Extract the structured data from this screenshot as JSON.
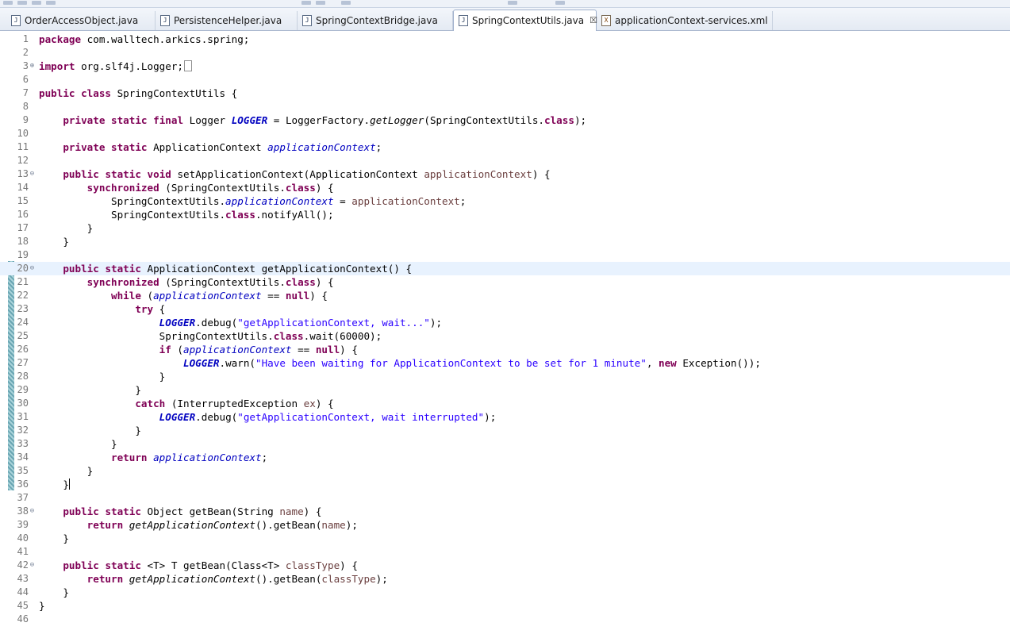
{
  "editor": {
    "tabs": [
      {
        "label": "OrderAccessObject.java",
        "icon": "java-file-icon",
        "active": false
      },
      {
        "label": "PersistenceHelper.java",
        "icon": "java-file-icon",
        "active": false
      },
      {
        "label": "SpringContextBridge.java",
        "icon": "java-file-icon",
        "active": false
      },
      {
        "label": "SpringContextUtils.java",
        "icon": "java-file-icon",
        "active": true,
        "close": "☒"
      },
      {
        "label": "applicationContext-services.xml",
        "icon": "xml-file-icon",
        "active": false
      }
    ],
    "current_line": 20,
    "code_lines": [
      {
        "n": "1",
        "tokens": [
          [
            "kw",
            "package"
          ],
          [
            "p",
            " com.walltech.arkics.spring;"
          ]
        ]
      },
      {
        "n": "2",
        "tokens": []
      },
      {
        "n": "3",
        "fold": "⊕",
        "tokens": [
          [
            "kw",
            "import"
          ],
          [
            "p",
            " org.slf4j.Logger;"
          ],
          [
            "box",
            ""
          ]
        ]
      },
      {
        "n": "6",
        "tokens": []
      },
      {
        "n": "7",
        "tokens": [
          [
            "kw",
            "public"
          ],
          [
            "p",
            " "
          ],
          [
            "kw",
            "class"
          ],
          [
            "p",
            " SpringContextUtils {"
          ]
        ]
      },
      {
        "n": "8",
        "tokens": []
      },
      {
        "n": "9",
        "tokens": [
          [
            "p",
            "    "
          ],
          [
            "kw",
            "private"
          ],
          [
            "p",
            " "
          ],
          [
            "kw",
            "static"
          ],
          [
            "p",
            " "
          ],
          [
            "kw",
            "final"
          ],
          [
            "p",
            " Logger "
          ],
          [
            "sf",
            "LOGGER"
          ],
          [
            "p",
            " = LoggerFactory."
          ],
          [
            "smeth",
            "getLogger"
          ],
          [
            "p",
            "(SpringContextUtils."
          ],
          [
            "kw",
            "class"
          ],
          [
            "p",
            ");"
          ]
        ]
      },
      {
        "n": "10",
        "tokens": []
      },
      {
        "n": "11",
        "tokens": [
          [
            "p",
            "    "
          ],
          [
            "kw",
            "private"
          ],
          [
            "p",
            " "
          ],
          [
            "kw",
            "static"
          ],
          [
            "p",
            " ApplicationContext "
          ],
          [
            "fld",
            "applicationContext"
          ],
          [
            "p",
            ";"
          ]
        ]
      },
      {
        "n": "12",
        "tokens": []
      },
      {
        "n": "13",
        "fold": "⊖",
        "tokens": [
          [
            "p",
            "    "
          ],
          [
            "kw",
            "public"
          ],
          [
            "p",
            " "
          ],
          [
            "kw",
            "static"
          ],
          [
            "p",
            " "
          ],
          [
            "kw",
            "void"
          ],
          [
            "p",
            " setApplicationContext(ApplicationContext "
          ],
          [
            "par",
            "applicationContext"
          ],
          [
            "p",
            ") {"
          ]
        ]
      },
      {
        "n": "14",
        "tokens": [
          [
            "p",
            "        "
          ],
          [
            "kw",
            "synchronized"
          ],
          [
            "p",
            " (SpringContextUtils."
          ],
          [
            "kw",
            "class"
          ],
          [
            "p",
            ") {"
          ]
        ]
      },
      {
        "n": "15",
        "tokens": [
          [
            "p",
            "            SpringContextUtils."
          ],
          [
            "fld",
            "applicationContext"
          ],
          [
            "p",
            " = "
          ],
          [
            "par",
            "applicationContext"
          ],
          [
            "p",
            ";"
          ]
        ]
      },
      {
        "n": "16",
        "tokens": [
          [
            "p",
            "            SpringContextUtils."
          ],
          [
            "kw",
            "class"
          ],
          [
            "p",
            ".notifyAll();"
          ]
        ]
      },
      {
        "n": "17",
        "tokens": [
          [
            "p",
            "        }"
          ]
        ]
      },
      {
        "n": "18",
        "tokens": [
          [
            "p",
            "    }"
          ]
        ]
      },
      {
        "n": "19",
        "tokens": []
      },
      {
        "n": "20",
        "fold": "⊖",
        "tokens": [
          [
            "p",
            "    "
          ],
          [
            "kw",
            "public"
          ],
          [
            "p",
            " "
          ],
          [
            "kw",
            "static"
          ],
          [
            "p",
            " ApplicationContext getApplicationContext() {"
          ]
        ]
      },
      {
        "n": "21",
        "tokens": [
          [
            "p",
            "        "
          ],
          [
            "kw",
            "synchronized"
          ],
          [
            "p",
            " (SpringContextUtils."
          ],
          [
            "kw",
            "class"
          ],
          [
            "p",
            ") {"
          ]
        ]
      },
      {
        "n": "22",
        "tokens": [
          [
            "p",
            "            "
          ],
          [
            "kw",
            "while"
          ],
          [
            "p",
            " ("
          ],
          [
            "fld",
            "applicationContext"
          ],
          [
            "p",
            " == "
          ],
          [
            "kw",
            "null"
          ],
          [
            "p",
            ") {"
          ]
        ]
      },
      {
        "n": "23",
        "tokens": [
          [
            "p",
            "                "
          ],
          [
            "kw",
            "try"
          ],
          [
            "p",
            " {"
          ]
        ]
      },
      {
        "n": "24",
        "tokens": [
          [
            "p",
            "                    "
          ],
          [
            "sf",
            "LOGGER"
          ],
          [
            "p",
            ".debug("
          ],
          [
            "str",
            "\"getApplicationContext, wait...\""
          ],
          [
            "p",
            ");"
          ]
        ]
      },
      {
        "n": "25",
        "tokens": [
          [
            "p",
            "                    SpringContextUtils."
          ],
          [
            "kw",
            "class"
          ],
          [
            "p",
            ".wait(60000);"
          ]
        ]
      },
      {
        "n": "26",
        "tokens": [
          [
            "p",
            "                    "
          ],
          [
            "kw",
            "if"
          ],
          [
            "p",
            " ("
          ],
          [
            "fld",
            "applicationContext"
          ],
          [
            "p",
            " == "
          ],
          [
            "kw",
            "null"
          ],
          [
            "p",
            ") {"
          ]
        ]
      },
      {
        "n": "27",
        "tokens": [
          [
            "p",
            "                        "
          ],
          [
            "sf",
            "LOGGER"
          ],
          [
            "p",
            ".warn("
          ],
          [
            "str",
            "\"Have been waiting for ApplicationContext to be set for 1 minute\""
          ],
          [
            "p",
            ", "
          ],
          [
            "kw",
            "new"
          ],
          [
            "p",
            " Exception());"
          ]
        ]
      },
      {
        "n": "28",
        "tokens": [
          [
            "p",
            "                    }"
          ]
        ]
      },
      {
        "n": "29",
        "tokens": [
          [
            "p",
            "                }"
          ]
        ]
      },
      {
        "n": "30",
        "tokens": [
          [
            "p",
            "                "
          ],
          [
            "kw",
            "catch"
          ],
          [
            "p",
            " (InterruptedException "
          ],
          [
            "par",
            "ex"
          ],
          [
            "p",
            ") {"
          ]
        ]
      },
      {
        "n": "31",
        "tokens": [
          [
            "p",
            "                    "
          ],
          [
            "sf",
            "LOGGER"
          ],
          [
            "p",
            ".debug("
          ],
          [
            "str",
            "\"getApplicationContext, wait interrupted\""
          ],
          [
            "p",
            ");"
          ]
        ]
      },
      {
        "n": "32",
        "tokens": [
          [
            "p",
            "                }"
          ]
        ]
      },
      {
        "n": "33",
        "tokens": [
          [
            "p",
            "            }"
          ]
        ]
      },
      {
        "n": "34",
        "tokens": [
          [
            "p",
            "            "
          ],
          [
            "kw",
            "return"
          ],
          [
            "p",
            " "
          ],
          [
            "fld",
            "applicationContext"
          ],
          [
            "p",
            ";"
          ]
        ]
      },
      {
        "n": "35",
        "tokens": [
          [
            "p",
            "        }"
          ]
        ]
      },
      {
        "n": "36",
        "tokens": [
          [
            "p",
            "    }"
          ],
          [
            "caret",
            ""
          ]
        ]
      },
      {
        "n": "37",
        "tokens": []
      },
      {
        "n": "38",
        "fold": "⊖",
        "tokens": [
          [
            "p",
            "    "
          ],
          [
            "kw",
            "public"
          ],
          [
            "p",
            " "
          ],
          [
            "kw",
            "static"
          ],
          [
            "p",
            " Object getBean(String "
          ],
          [
            "par",
            "name"
          ],
          [
            "p",
            ") {"
          ]
        ]
      },
      {
        "n": "39",
        "tokens": [
          [
            "p",
            "        "
          ],
          [
            "kw",
            "return"
          ],
          [
            "p",
            " "
          ],
          [
            "smeth",
            "getApplicationContext"
          ],
          [
            "p",
            "().getBean("
          ],
          [
            "par",
            "name"
          ],
          [
            "p",
            ");"
          ]
        ]
      },
      {
        "n": "40",
        "tokens": [
          [
            "p",
            "    }"
          ]
        ]
      },
      {
        "n": "41",
        "tokens": []
      },
      {
        "n": "42",
        "fold": "⊖",
        "tokens": [
          [
            "p",
            "    "
          ],
          [
            "kw",
            "public"
          ],
          [
            "p",
            " "
          ],
          [
            "kw",
            "static"
          ],
          [
            "p",
            " <T> T getBean(Class<T> "
          ],
          [
            "par",
            "classType"
          ],
          [
            "p",
            ") {"
          ]
        ]
      },
      {
        "n": "43",
        "tokens": [
          [
            "p",
            "        "
          ],
          [
            "kw",
            "return"
          ],
          [
            "p",
            " "
          ],
          [
            "smeth",
            "getApplicationContext"
          ],
          [
            "p",
            "().getBean("
          ],
          [
            "par",
            "classType"
          ],
          [
            "p",
            ");"
          ]
        ]
      },
      {
        "n": "44",
        "tokens": [
          [
            "p",
            "    }"
          ]
        ]
      },
      {
        "n": "45",
        "tokens": [
          [
            "p",
            "}"
          ]
        ]
      },
      {
        "n": "46",
        "tokens": []
      }
    ]
  }
}
